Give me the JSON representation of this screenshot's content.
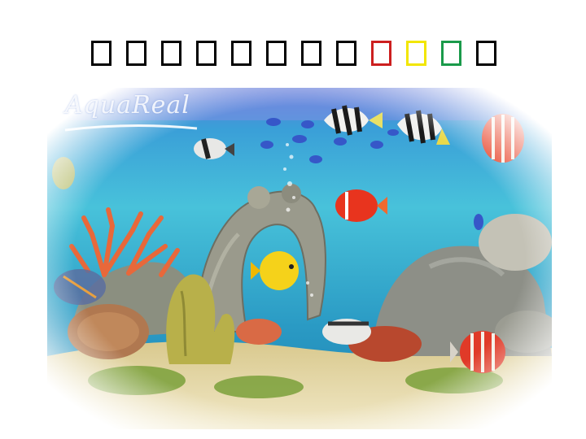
{
  "title": {
    "glyphs": [
      {
        "char": "□",
        "color": "#000000"
      },
      {
        "char": "□",
        "color": "#000000"
      },
      {
        "char": "□",
        "color": "#000000"
      },
      {
        "char": "□",
        "color": "#000000"
      },
      {
        "char": "□",
        "color": "#000000"
      },
      {
        "char": "□",
        "color": "#000000"
      },
      {
        "char": "□",
        "color": "#000000"
      },
      {
        "char": "□",
        "color": "#000000"
      },
      {
        "char": "□",
        "color": "#cc1f1f"
      },
      {
        "char": "□",
        "color": "#f2e600"
      },
      {
        "char": "□",
        "color": "#1a9a4a"
      },
      {
        "char": "□",
        "color": "#000000"
      }
    ]
  },
  "photo": {
    "watermark": "AquaReal",
    "colors": {
      "water_top": "#2a7fc9",
      "water_mid": "#3fb6d6",
      "water_bottom": "#1f8fb8",
      "sand": "#e8d9a8",
      "coral_orange": "#e8683a",
      "coral_yellow": "#c9b84a",
      "rock": "#8d8f87"
    }
  }
}
